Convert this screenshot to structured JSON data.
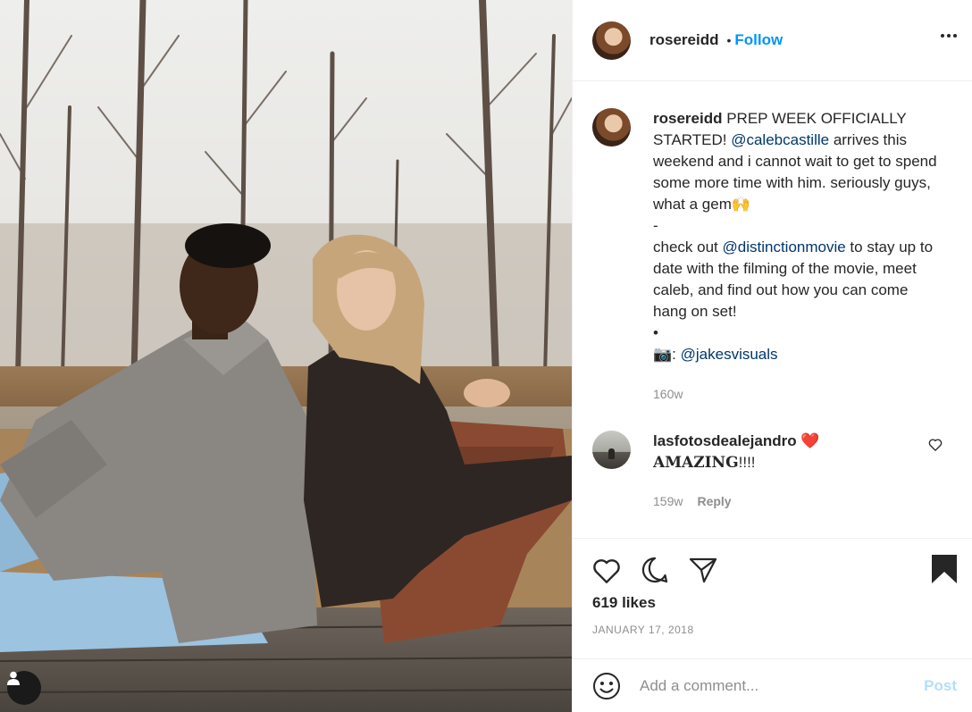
{
  "post": {
    "author": "rosereidd",
    "follow_label": "Follow",
    "separator": "•",
    "more_icon": "more-horizontal-icon"
  },
  "caption": {
    "username": "rosereidd",
    "line1_a": " PREP WEEK OFFICIALLY STARTED! ",
    "mention1": "@calebcastille",
    "line1_b": " arrives this weekend and i cannot wait to get to spend some more time with him. seriously guys, what a gem",
    "emoji1": "🙌",
    "divider": "-",
    "line2_a": "check out ",
    "mention2": "@distinctionmovie",
    "line2_b": " to stay up to date with the filming of the movie, meet caleb, and find out how you can come hang on set!",
    "bullet": "•",
    "camera_emoji": "📷",
    "colon": ": ",
    "mention3": "@jakesvisuals",
    "time": "160w"
  },
  "comments": [
    {
      "username": "lasfotosdealejandro",
      "heart_emoji": "❤️",
      "text_bold": "AMAZING",
      "text_rest": "!!!!",
      "time": "159w",
      "reply_label": "Reply"
    }
  ],
  "actions": {
    "likes": "619 likes",
    "date": "JANUARY 17, 2018"
  },
  "composer": {
    "placeholder": "Add a comment...",
    "post_label": "Post"
  },
  "colors": {
    "accent": "#0095f6",
    "mention": "#00376b",
    "muted": "#8e8e8e",
    "post_disabled": "#b2dffc"
  }
}
